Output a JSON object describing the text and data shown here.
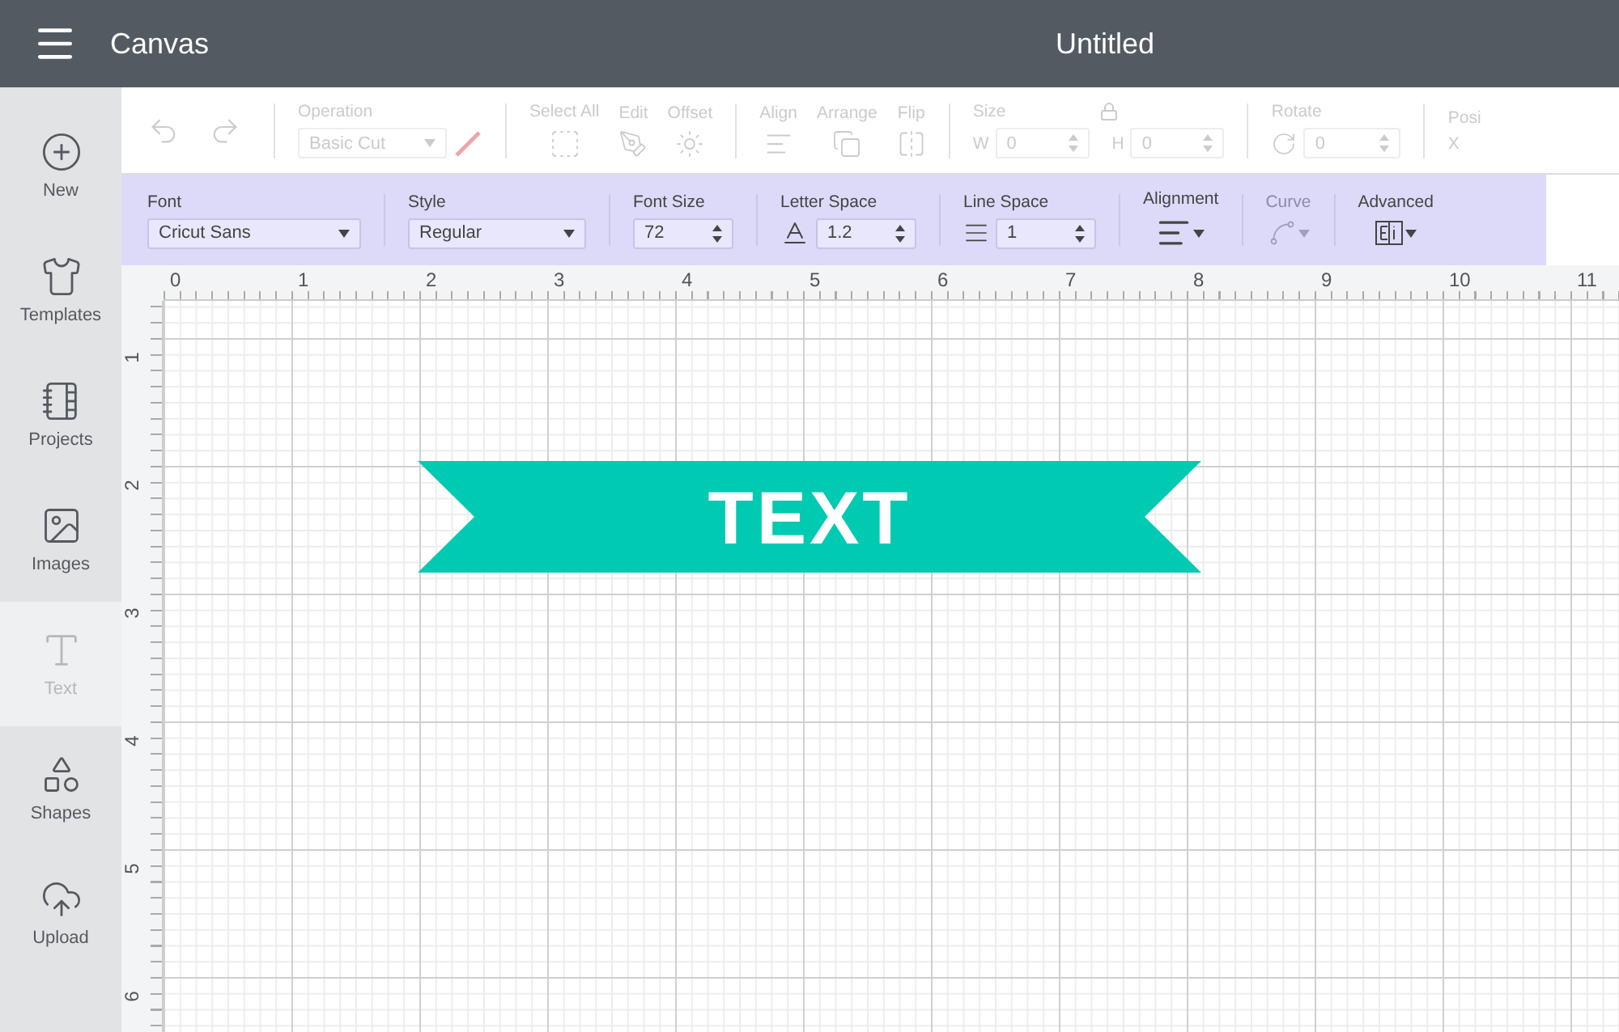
{
  "header": {
    "title": "Canvas",
    "document": "Untitled"
  },
  "sidebar": [
    {
      "kind": "new",
      "label": "New",
      "selected": false
    },
    {
      "kind": "templates",
      "label": "Templates",
      "selected": false
    },
    {
      "kind": "projects",
      "label": "Projects",
      "selected": false
    },
    {
      "kind": "images",
      "label": "Images",
      "selected": false
    },
    {
      "kind": "text",
      "label": "Text",
      "selected": true
    },
    {
      "kind": "shapes",
      "label": "Shapes",
      "selected": false
    },
    {
      "kind": "upload",
      "label": "Upload",
      "selected": false
    }
  ],
  "edit_toolbar": {
    "disabled": true,
    "operation": {
      "label": "Operation",
      "value": "Basic Cut"
    },
    "select_all": "Select All",
    "edit": "Edit",
    "offset": "Offset",
    "align": "Align",
    "arrange": "Arrange",
    "flip": "Flip",
    "size": {
      "label": "Size",
      "w_label": "W",
      "w_value": "0",
      "h_label": "H",
      "h_value": "0"
    },
    "rotate": {
      "label": "Rotate",
      "value": "0"
    },
    "position": {
      "label": "Posi",
      "x_label": "X"
    }
  },
  "text_toolbar": {
    "font": {
      "label": "Font",
      "value": "Cricut Sans"
    },
    "style": {
      "label": "Style",
      "value": "Regular"
    },
    "font_size": {
      "label": "Font Size",
      "value": "72"
    },
    "letter_space": {
      "label": "Letter Space",
      "value": "1.2"
    },
    "line_space": {
      "label": "Line Space",
      "value": "1"
    },
    "alignment": {
      "label": "Alignment"
    },
    "curve": {
      "label": "Curve",
      "disabled": true
    },
    "advanced": {
      "label": "Advanced"
    }
  },
  "ruler": {
    "x_labels": [
      "0",
      "1",
      "2",
      "3",
      "4",
      "5",
      "6",
      "7",
      "8",
      "9",
      "10",
      "11"
    ],
    "y_labels": [
      "1",
      "2",
      "3",
      "4",
      "5",
      "6"
    ]
  },
  "canvas": {
    "text": "TEXT"
  }
}
